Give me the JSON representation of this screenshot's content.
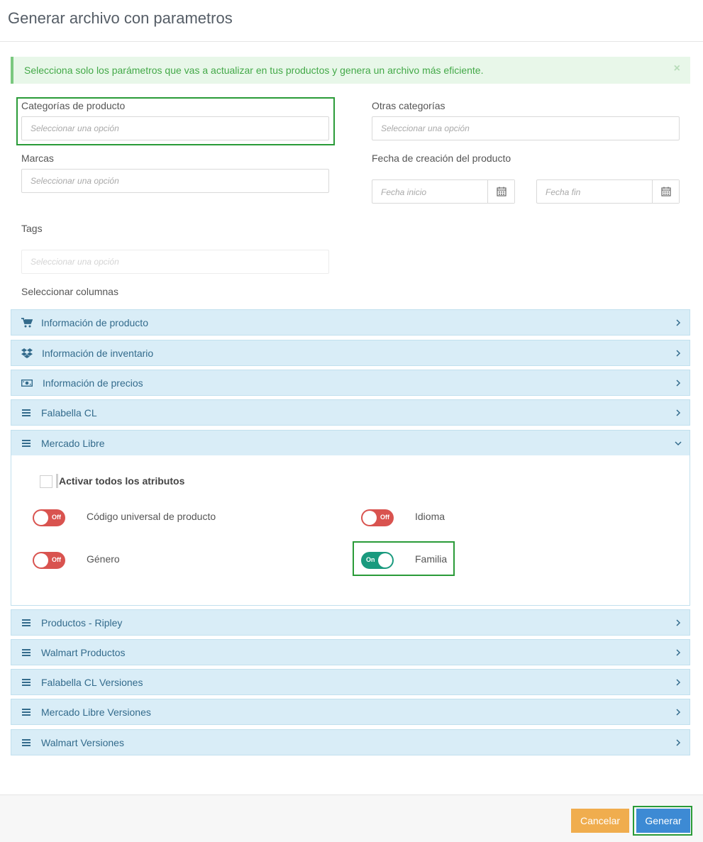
{
  "modal": {
    "title": "Generar archivo con parametros"
  },
  "alert": {
    "text": "Selecciona solo los parámetros que vas a actualizar en tus productos y genera un archivo más eficiente.",
    "close": "×"
  },
  "fields": {
    "categorias": {
      "label": "Categorías de producto",
      "placeholder": "Seleccionar una opción"
    },
    "otras": {
      "label": "Otras categorías",
      "placeholder": "Seleccionar una opción"
    },
    "marcas": {
      "label": "Marcas",
      "placeholder": "Seleccionar una opción"
    },
    "fecha": {
      "label": "Fecha de creación del producto",
      "start_placeholder": "Fecha inicio",
      "end_placeholder": "Fecha fin"
    },
    "tags": {
      "label": "Tags",
      "placeholder": "Seleccionar una opción"
    }
  },
  "columns": {
    "label": "Seleccionar columnas",
    "items": [
      {
        "label": "Información de producto",
        "icon": "cart-icon"
      },
      {
        "label": "Información de inventario",
        "icon": "dropbox-icon"
      },
      {
        "label": "Información de precios",
        "icon": "money-icon"
      },
      {
        "label": "Falabella CL",
        "icon": "list-icon"
      },
      {
        "label": "Mercado Libre",
        "icon": "list-icon",
        "expanded": true
      },
      {
        "label": "Productos - Ripley",
        "icon": "list-icon"
      },
      {
        "label": "Walmart Productos",
        "icon": "list-icon"
      },
      {
        "label": "Falabella CL Versiones",
        "icon": "list-icon"
      },
      {
        "label": "Mercado Libre Versiones",
        "icon": "list-icon"
      },
      {
        "label": "Walmart Versiones",
        "icon": "list-icon"
      }
    ]
  },
  "mercado_libre": {
    "select_all": "Activar todos los atributos",
    "attributes": [
      {
        "label": "Código universal de producto",
        "state": "Off"
      },
      {
        "label": "Idioma",
        "state": "Off"
      },
      {
        "label": "Género",
        "state": "Off"
      },
      {
        "label": "Familia",
        "state": "On"
      }
    ]
  },
  "footer": {
    "cancel": "Cancelar",
    "generate": "Generar"
  },
  "colors": {
    "accordion_bg": "#d9edf7",
    "accordion_text": "#336b8c",
    "toggle_off": "#d9534f",
    "toggle_on": "#1a9a7e",
    "cancel": "#f0ad4e",
    "generate": "#3d8ad4",
    "highlight": "#2a9b38"
  }
}
